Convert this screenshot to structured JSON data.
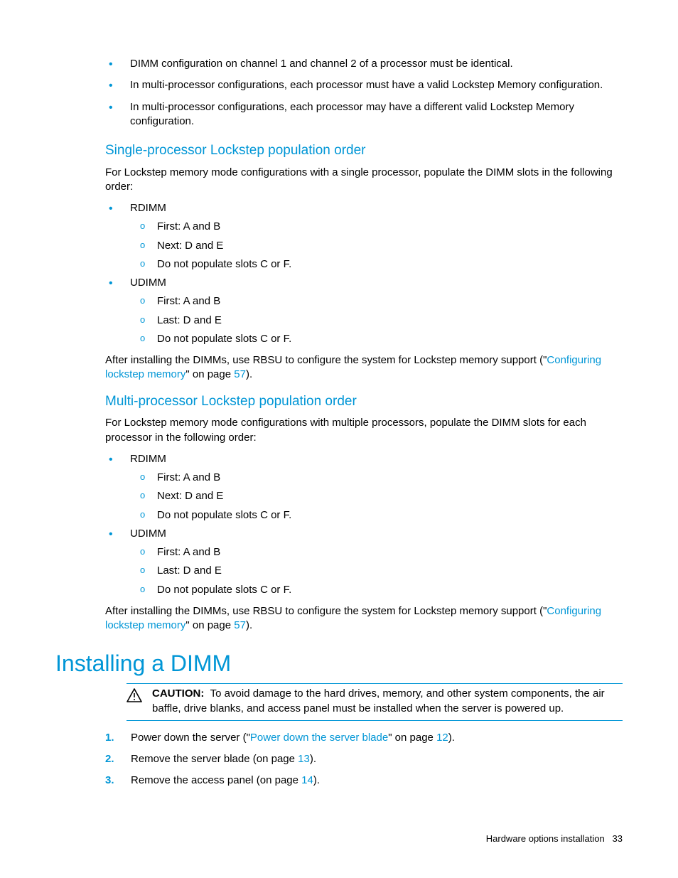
{
  "intro_bullets": [
    "DIMM configuration on channel 1 and channel 2 of a processor must be identical.",
    "In multi-processor configurations, each processor must have a valid Lockstep Memory configuration.",
    "In multi-processor configurations, each processor may have a different valid Lockstep Memory configuration."
  ],
  "single": {
    "heading": "Single-processor Lockstep population order",
    "intro": "For Lockstep memory mode configurations with a single processor, populate the DIMM slots in the following order:",
    "rdimm_label": "RDIMM",
    "rdimm_items": [
      "First: A and B",
      "Next: D and E",
      "Do not populate slots C or F."
    ],
    "udimm_label": "UDIMM",
    "udimm_items": [
      "First: A and B",
      "Last: D and E",
      "Do not populate slots C or F."
    ],
    "after_pre": "After installing the DIMMs, use RBSU to configure the system for Lockstep memory support (\"",
    "after_link": "Configuring lockstep memory",
    "after_mid": "\" on page ",
    "after_page": "57",
    "after_post": ")."
  },
  "multi": {
    "heading": "Multi-processor Lockstep population order",
    "intro": "For Lockstep memory mode configurations with multiple processors, populate the DIMM slots for each processor in the following order:",
    "rdimm_label": "RDIMM",
    "rdimm_items": [
      "First: A and B",
      "Next: D and E",
      "Do not populate slots C or F."
    ],
    "udimm_label": "UDIMM",
    "udimm_items": [
      "First: A and B",
      "Last: D and E",
      "Do not populate slots C or F."
    ],
    "after_pre": "After installing the DIMMs, use RBSU to configure the system for Lockstep memory support (\"",
    "after_link": "Configuring lockstep memory",
    "after_mid": "\" on page ",
    "after_page": "57",
    "after_post": ")."
  },
  "install": {
    "heading": "Installing a DIMM",
    "caution_label": "CAUTION:",
    "caution_text": "To avoid damage to the hard drives, memory, and other system components, the air baffle, drive blanks, and access panel must be installed when the server is powered up.",
    "steps": [
      {
        "pre": "Power down the server (\"",
        "link": "Power down the server blade",
        "mid": "\" on page ",
        "page": "12",
        "post": ")."
      },
      {
        "pre": "Remove the server blade (on page ",
        "link": "",
        "mid": "",
        "page": "13",
        "post": ")."
      },
      {
        "pre": "Remove the access panel (on page ",
        "link": "",
        "mid": "",
        "page": "14",
        "post": ")."
      }
    ]
  },
  "footer": {
    "section": "Hardware options installation",
    "page": "33"
  }
}
